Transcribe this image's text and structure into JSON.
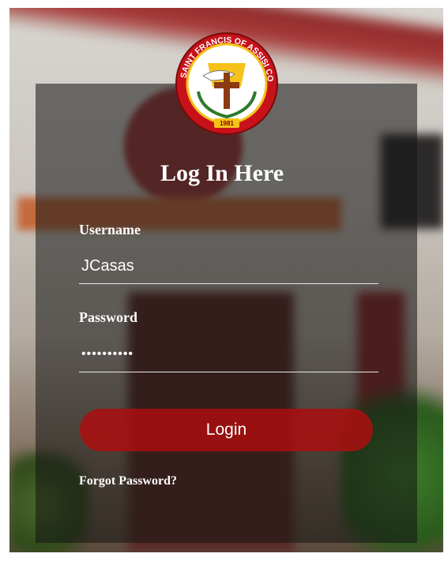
{
  "logo": {
    "text": "SAINT FRANCIS OF ASSISI COLLEGE",
    "year": "1981",
    "primary_color": "#d0181c",
    "accent_color": "#f2c418"
  },
  "title": "Log In Here",
  "username": {
    "label": "Username",
    "value": "JCasas"
  },
  "password": {
    "label": "Password",
    "value": "••••••••••"
  },
  "login_button": {
    "label": "Login",
    "color": "#ab0e0e"
  },
  "forgot_link": {
    "label": "Forgot Password?"
  }
}
